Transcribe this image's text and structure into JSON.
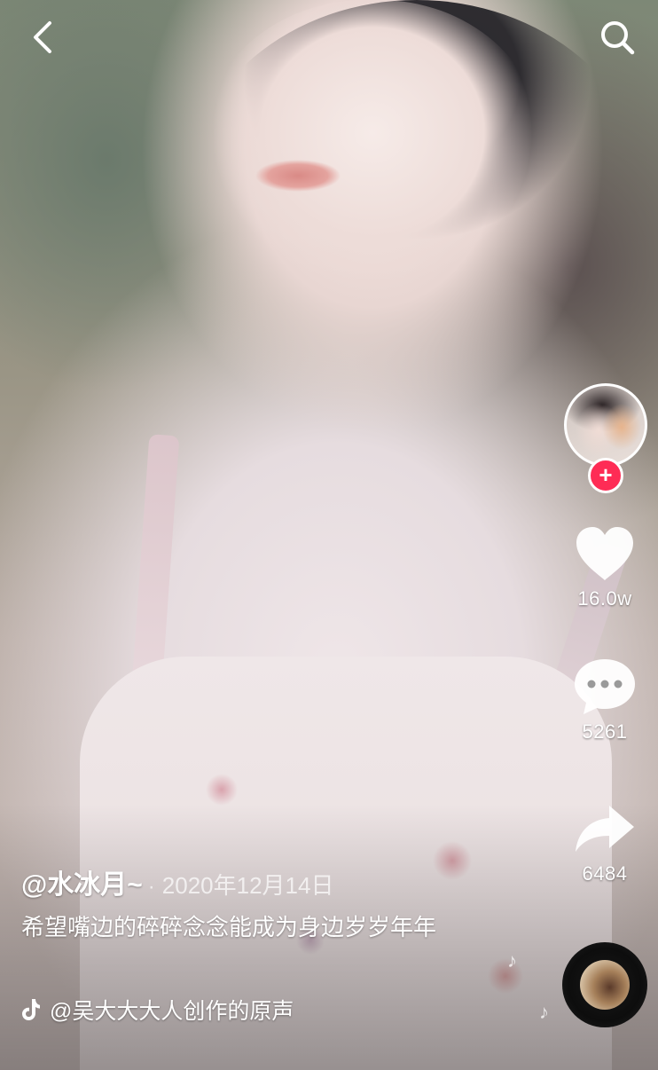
{
  "top_bar": {
    "back_icon": "chevron-left-icon",
    "search_icon": "search-icon"
  },
  "rail": {
    "avatar_icon": "user-avatar",
    "follow_symbol": "+",
    "like": {
      "icon": "heart-icon",
      "count": "16.0w"
    },
    "comment": {
      "icon": "comment-icon",
      "count": "5261"
    },
    "share": {
      "icon": "share-arrow-icon",
      "count": "6484"
    }
  },
  "caption": {
    "author": "@水冰月~",
    "separator": "·",
    "date": "2020年12月14日",
    "description": "希望嘴边的碎碎念念能成为身边岁岁年年"
  },
  "music": {
    "icon": "tiktok-logo-icon",
    "title": "@吴大大大人创作的原声",
    "note_symbol": "♪"
  },
  "colors": {
    "accent": "#fe2c55",
    "text": "#ffffff"
  }
}
